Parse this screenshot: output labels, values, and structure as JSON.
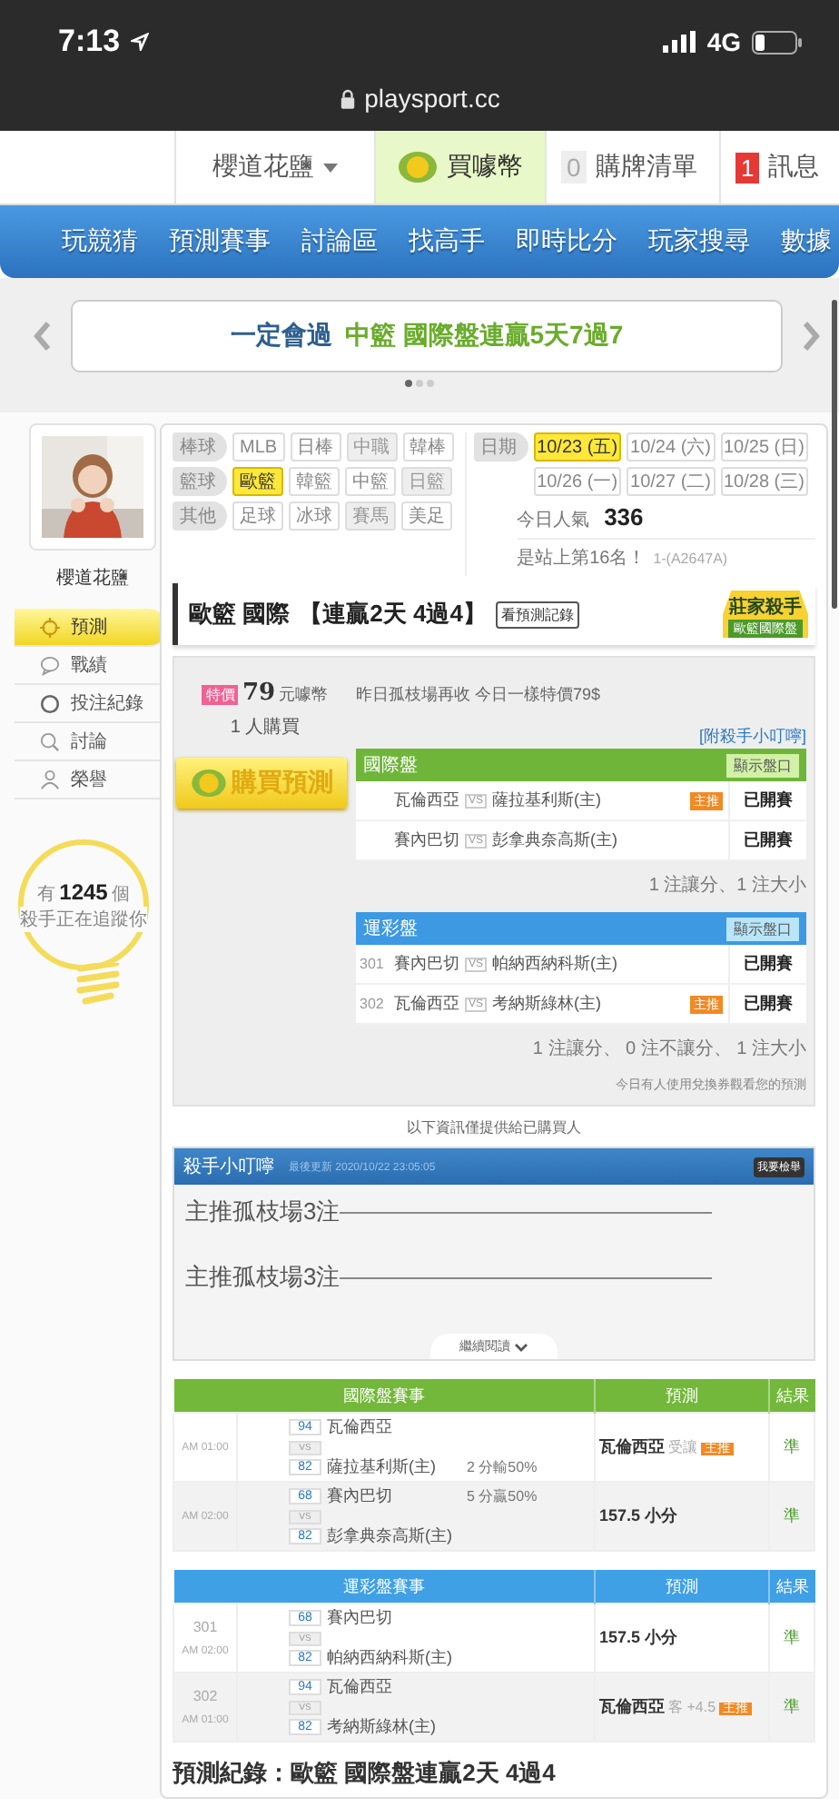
{
  "status_bar": {
    "time": "7:13",
    "network": "4G"
  },
  "browser": {
    "url": "playsport.cc"
  },
  "top_nav": {
    "user": "櫻道花鹽",
    "coin_button": "買噱幣",
    "cart": {
      "count": "0",
      "label": "購牌清單"
    },
    "messages": {
      "count": "1",
      "label": "訊息"
    }
  },
  "main_menu": [
    "玩競猜",
    "預測賽事",
    "討論區",
    "找高手",
    "即時比分",
    "玩家搜尋",
    "數據"
  ],
  "banner": {
    "segments": [
      {
        "text": "一定會過",
        "color": "#2d5f8e"
      },
      {
        "text": "中籃 國際盤連贏5天7過7",
        "color": "#6aac2c"
      }
    ],
    "dots": [
      {
        "selected": true
      },
      {
        "selected": false
      },
      {
        "selected": false
      }
    ]
  },
  "profile": {
    "name": "櫻道花鹽"
  },
  "sidebar": {
    "items": [
      {
        "label": "預測",
        "selected": true
      },
      {
        "label": "戰績",
        "selected": false
      },
      {
        "label": "投注紀錄",
        "selected": false
      },
      {
        "label": "討論",
        "selected": false
      },
      {
        "label": "榮譽",
        "selected": false
      }
    ]
  },
  "followers": {
    "prefix": "有",
    "count": "1245",
    "suffix": "個",
    "caption": "殺手正在追蹤你"
  },
  "filters": {
    "rows": [
      {
        "category": "棒球",
        "options": [
          {
            "label": "MLB",
            "selected": false,
            "disabled": false
          },
          {
            "label": "日棒",
            "selected": false,
            "disabled": false
          },
          {
            "label": "中職",
            "selected": false,
            "disabled": true
          },
          {
            "label": "韓棒",
            "selected": false,
            "disabled": false
          }
        ]
      },
      {
        "category": "籃球",
        "options": [
          {
            "label": "歐籃",
            "selected": true,
            "disabled": false
          },
          {
            "label": "韓籃",
            "selected": false,
            "disabled": false
          },
          {
            "label": "中籃",
            "selected": false,
            "disabled": false
          },
          {
            "label": "日籃",
            "selected": false,
            "disabled": true
          }
        ]
      },
      {
        "category": "其他",
        "options": [
          {
            "label": "足球",
            "selected": false,
            "disabled": false
          },
          {
            "label": "冰球",
            "selected": false,
            "disabled": false
          },
          {
            "label": "賽馬",
            "selected": false,
            "disabled": true
          },
          {
            "label": "美足",
            "selected": false,
            "disabled": false
          }
        ]
      }
    ]
  },
  "dates": {
    "label": "日期",
    "options": [
      {
        "label": "10/23 (五)",
        "selected": true
      },
      {
        "label": "10/24 (六)",
        "selected": false
      },
      {
        "label": "10/25 (日)",
        "selected": false
      },
      {
        "label": "10/26 (一)",
        "selected": false
      },
      {
        "label": "10/27 (二)",
        "selected": false
      },
      {
        "label": "10/28 (三)",
        "selected": false
      }
    ]
  },
  "popularity": {
    "label": "今日人氣",
    "value": "336",
    "rank": "是站上第16名！",
    "note": "1-(A2647A)"
  },
  "prediction": {
    "title": "歐籃 國際",
    "streak": "【連贏2天 4過4】",
    "records_button": "看預測記錄",
    "badge": {
      "title": "莊家殺手",
      "subtitle": "歐籃國際盤"
    },
    "price_tag": "特價",
    "price": "79",
    "currency": "元噱幣",
    "buyers": "1 人購買",
    "buy_button": "購買預測",
    "message": "昨日孤枝場再收 今日一樣特價79$",
    "tips_link": "[附殺手小叮嚀]",
    "panels": [
      {
        "kind": "intl",
        "title": "國際盤",
        "toggle": "顯示盤口",
        "summary": "1 注讓分、1 注大小",
        "rows": [
          {
            "away": "瓦倫西亞",
            "vs": "VS",
            "home": "薩拉基利斯(主)",
            "tag": "主推",
            "status": "已開賽"
          },
          {
            "away": "賽內巴切",
            "vs": "VS",
            "home": "彭拿典奈高斯(主)",
            "status": "已開賽"
          }
        ]
      },
      {
        "kind": "lottery",
        "title": "運彩盤",
        "toggle": "顯示盤口",
        "summary": "1 注讓分、 0 注不讓分、 1 注大小",
        "rows": [
          {
            "number": "301",
            "away": "賽內巴切",
            "vs": "VS",
            "home": "帕納西納科斯(主)",
            "status": "已開賽"
          },
          {
            "number": "302",
            "away": "瓦倫西亞",
            "vs": "VS",
            "home": "考納斯綠林(主)",
            "tag": "主推",
            "status": "已開賽"
          }
        ]
      }
    ],
    "notice": "今日有人使用兌換券觀看您的預測"
  },
  "buyers_only": "以下資訊僅提供給已購買人",
  "tips": {
    "title": "殺手小叮嚀",
    "updated": "最後更新 2020/10/22 23:05:05",
    "report_button": "我要檢舉",
    "lines": [
      "主推孤枝場3注",
      "主推孤枝場3注"
    ],
    "more": "繼續閱讀"
  },
  "results": [
    {
      "kind": "intl",
      "headers": [
        "國際盤賽事",
        "預測",
        "結果"
      ],
      "rows": [
        {
          "time": "AM 01:00",
          "away_score": "94",
          "away": "瓦倫西亞",
          "vs": "VS",
          "home_score": "82",
          "home": "薩拉基利斯(主)",
          "home_line": "2 分輸50%",
          "pick": "瓦倫西亞",
          "pick_note": "受讓",
          "tag": "主推",
          "result": "準"
        },
        {
          "time": "AM 02:00",
          "away_score": "68",
          "away": "賽內巴切",
          "vs": "VS",
          "home_score": "82",
          "home": "彭拿典奈高斯(主)",
          "away_line": "5 分贏50%",
          "pick": "157.5 小分",
          "result": "準"
        }
      ]
    },
    {
      "kind": "lottery",
      "headers": [
        "運彩盤賽事",
        "預測",
        "結果"
      ],
      "rows": [
        {
          "number": "301",
          "time": "AM 02:00",
          "away_score": "68",
          "away": "賽內巴切",
          "vs": "VS",
          "home_score": "82",
          "home": "帕納西納科斯(主)",
          "pick": "157.5 小分",
          "result": "準"
        },
        {
          "number": "302",
          "time": "AM 01:00",
          "away_score": "94",
          "away": "瓦倫西亞",
          "vs": "VS",
          "home_score": "82",
          "home": "考納斯綠林(主)",
          "pick": "瓦倫西亞",
          "pick_note": "客 +4.5",
          "tag": "主推",
          "result": "準"
        }
      ]
    }
  ],
  "footer": "預測紀錄：歐籃 國際盤連贏2天 4過4"
}
